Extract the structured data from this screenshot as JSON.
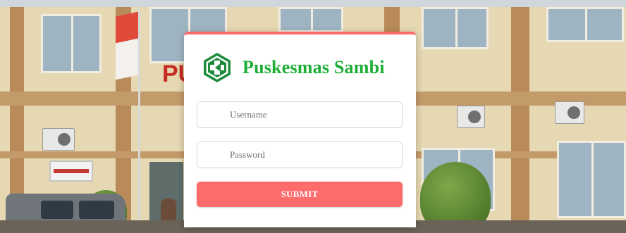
{
  "app": {
    "name": "Puskesmas Sambi",
    "accent_color": "#fe6b6b",
    "brand_color": "#1cae35"
  },
  "login": {
    "username_placeholder": "Username",
    "password_placeholder": "Password",
    "submit_label": "SUBMIT"
  },
  "background": {
    "sign_letters": "PU",
    "icon": "puskesmas-logo-icon"
  }
}
